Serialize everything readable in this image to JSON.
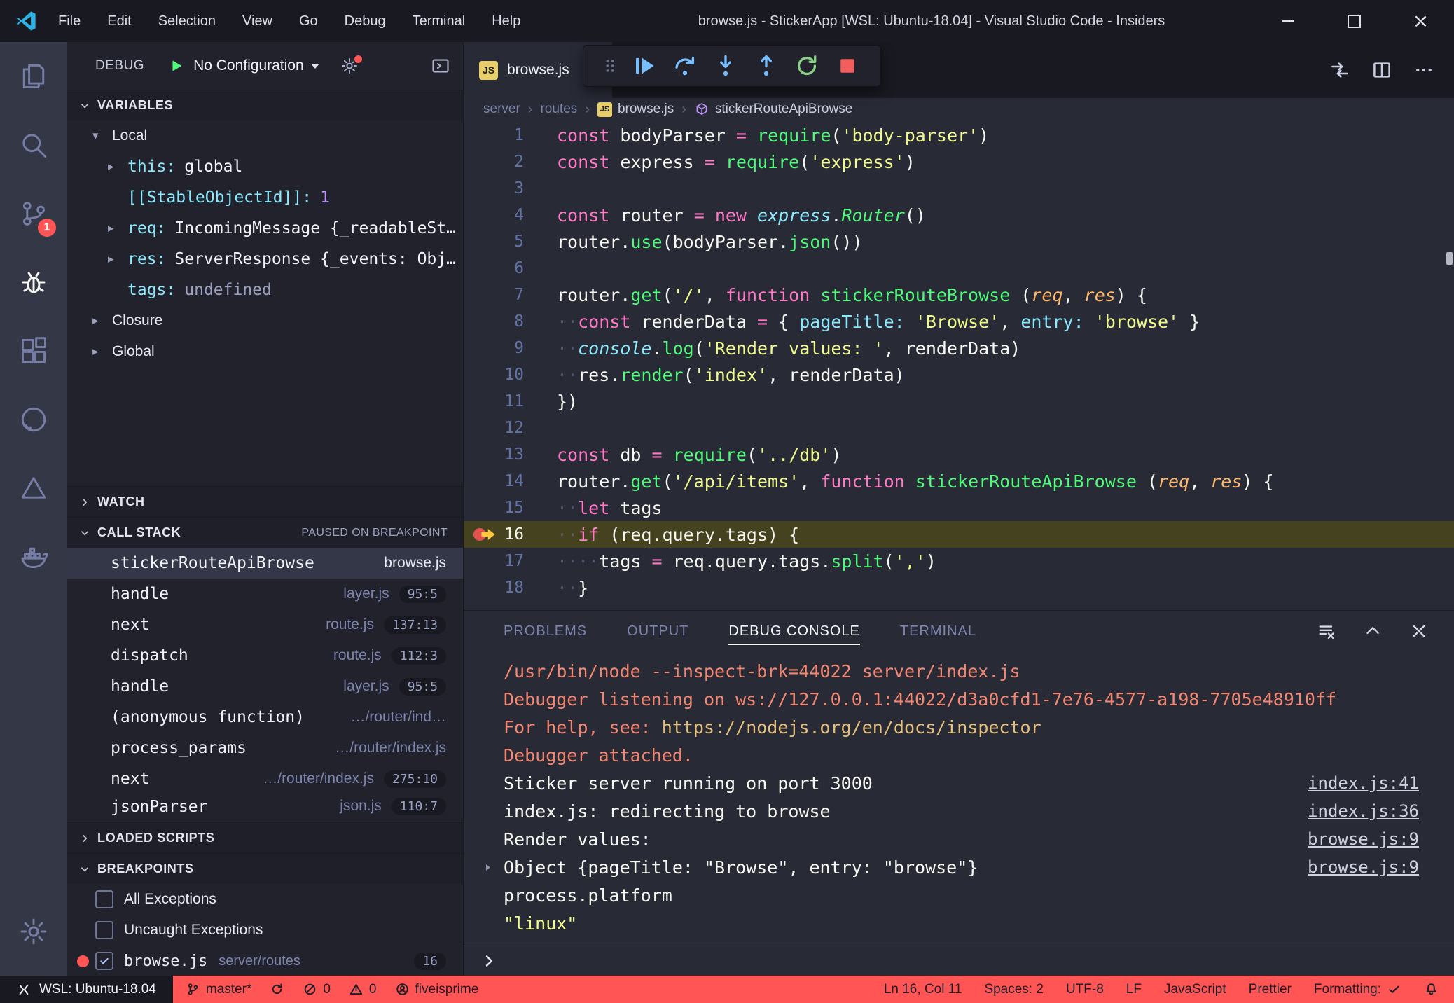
{
  "title_bar": {
    "title": "browse.js - StickerApp [WSL: Ubuntu-18.04] - Visual Studio Code - Insiders",
    "menus": [
      "File",
      "Edit",
      "Selection",
      "View",
      "Go",
      "Debug",
      "Terminal",
      "Help"
    ],
    "window_controls": [
      "minimize",
      "maximize",
      "close"
    ]
  },
  "activity_bar": {
    "items": [
      {
        "icon": "explorer"
      },
      {
        "icon": "search"
      },
      {
        "icon": "source-control",
        "badge": "1"
      },
      {
        "icon": "debug",
        "active": true
      },
      {
        "icon": "extensions"
      },
      {
        "icon": "github"
      },
      {
        "icon": "azure"
      },
      {
        "icon": "docker"
      }
    ],
    "bottom": [
      {
        "icon": "settings"
      }
    ]
  },
  "sidebar": {
    "header": {
      "title": "DEBUG",
      "config_label": "No Configuration"
    },
    "variables": {
      "label": "VARIABLES",
      "rows": [
        {
          "kind": "scope",
          "label": "Local",
          "chevron": "down"
        },
        {
          "kind": "var",
          "chevron": "right",
          "name": "this",
          "value": "global"
        },
        {
          "kind": "var",
          "name": "[[StableObjectId]]",
          "value": "1",
          "vclass": "num"
        },
        {
          "kind": "var",
          "chevron": "right",
          "name": "req",
          "value": "IncomingMessage {_readableSt…"
        },
        {
          "kind": "var",
          "chevron": "right",
          "name": "res",
          "value": "ServerResponse {_events: Obj…"
        },
        {
          "kind": "var",
          "name": "tags",
          "value": "undefined",
          "vclass": "muted"
        },
        {
          "kind": "scope",
          "label": "Closure",
          "chevron": "right"
        },
        {
          "kind": "scope",
          "label": "Global",
          "chevron": "right"
        }
      ]
    },
    "watch": {
      "label": "WATCH"
    },
    "call_stack": {
      "label": "CALL STACK",
      "status": "PAUSED ON BREAKPOINT",
      "frames": [
        {
          "name": "stickerRouteApiBrowse",
          "file": "browse.js",
          "selected": true
        },
        {
          "name": "handle",
          "file": "layer.js",
          "badge": "95:5"
        },
        {
          "name": "next",
          "file": "route.js",
          "badge": "137:13"
        },
        {
          "name": "dispatch",
          "file": "route.js",
          "badge": "112:3"
        },
        {
          "name": "handle",
          "file": "layer.js",
          "badge": "95:5"
        },
        {
          "name": "(anonymous function)",
          "file": "…/router/ind…"
        },
        {
          "name": "process_params",
          "file": "…/router/index.js"
        },
        {
          "name": "next",
          "file": "…/router/index.js",
          "badge": "275:10"
        },
        {
          "name": "jsonParser",
          "file": "json.js",
          "badge": "110:7",
          "clipped": true
        }
      ]
    },
    "loaded_scripts": {
      "label": "LOADED SCRIPTS"
    },
    "breakpoints": {
      "label": "BREAKPOINTS",
      "items": [
        {
          "label": "All Exceptions",
          "checked": false
        },
        {
          "label": "Uncaught Exceptions",
          "checked": false
        },
        {
          "label": "browse.js",
          "mono": true,
          "detail": "server/routes",
          "checked": true,
          "dot": true,
          "badge": "16"
        }
      ]
    }
  },
  "editor": {
    "tab": {
      "label": "browse.js",
      "icon_text": "JS"
    },
    "actions": [
      "open-changes",
      "split-editor",
      "more-actions"
    ],
    "debug_toolbar": [
      "grip",
      "continue",
      "step-over",
      "step-into",
      "step-out",
      "restart",
      "stop"
    ],
    "breadcrumbs": [
      {
        "label": "server"
      },
      {
        "label": "routes"
      },
      {
        "label": "browse.js",
        "icon": "js"
      },
      {
        "label": "stickerRouteApiBrowse",
        "icon": "symbol-method"
      }
    ],
    "code": {
      "current_line": 16,
      "lines": [
        {
          "n": 1,
          "t": [
            [
              "k",
              "const"
            ],
            [
              "v",
              " bodyParser "
            ],
            [
              "k",
              "="
            ],
            [
              "v",
              " "
            ],
            [
              "f",
              "require"
            ],
            [
              "v",
              "("
            ],
            [
              "s",
              "'body-parser'"
            ],
            [
              "v",
              ")"
            ]
          ]
        },
        {
          "n": 2,
          "t": [
            [
              "k",
              "const"
            ],
            [
              "v",
              " express "
            ],
            [
              "k",
              "="
            ],
            [
              "v",
              " "
            ],
            [
              "f",
              "require"
            ],
            [
              "v",
              "("
            ],
            [
              "s",
              "'express'"
            ],
            [
              "v",
              ")"
            ]
          ]
        },
        {
          "n": 3,
          "t": []
        },
        {
          "n": 4,
          "t": [
            [
              "k",
              "const"
            ],
            [
              "v",
              " router "
            ],
            [
              "k",
              "="
            ],
            [
              "v",
              " "
            ],
            [
              "k",
              "new"
            ],
            [
              "v",
              " "
            ],
            [
              "ci",
              "express"
            ],
            [
              "v",
              "."
            ],
            [
              "gi",
              "Router"
            ],
            [
              "v",
              "()"
            ]
          ]
        },
        {
          "n": 5,
          "t": [
            [
              "v",
              "router."
            ],
            [
              "f",
              "use"
            ],
            [
              "v",
              "("
            ],
            [
              "v",
              "bodyParser."
            ],
            [
              "f",
              "json"
            ],
            [
              "v",
              "())"
            ]
          ]
        },
        {
          "n": 6,
          "t": []
        },
        {
          "n": 7,
          "t": [
            [
              "v",
              "router."
            ],
            [
              "f",
              "get"
            ],
            [
              "v",
              "("
            ],
            [
              "s",
              "'/'"
            ],
            [
              "v",
              ", "
            ],
            [
              "k",
              "function"
            ],
            [
              "v",
              " "
            ],
            [
              "f",
              "stickerRouteBrowse"
            ],
            [
              "v",
              " ("
            ],
            [
              "ai",
              "req"
            ],
            [
              "v",
              ", "
            ],
            [
              "ai",
              "res"
            ],
            [
              "v",
              ") {"
            ]
          ]
        },
        {
          "n": 8,
          "t": [
            [
              "ws",
              "··"
            ],
            [
              "k",
              "const"
            ],
            [
              "v",
              " renderData "
            ],
            [
              "k",
              "="
            ],
            [
              "v",
              " { "
            ],
            [
              "key",
              "pageTitle:"
            ],
            [
              "v",
              " "
            ],
            [
              "s",
              "'Browse'"
            ],
            [
              "v",
              ", "
            ],
            [
              "key",
              "entry:"
            ],
            [
              "v",
              " "
            ],
            [
              "s",
              "'browse'"
            ],
            [
              "v",
              " }"
            ]
          ]
        },
        {
          "n": 9,
          "t": [
            [
              "ws",
              "··"
            ],
            [
              "ci",
              "console"
            ],
            [
              "v",
              "."
            ],
            [
              "f",
              "log"
            ],
            [
              "v",
              "("
            ],
            [
              "s",
              "'Render values: '"
            ],
            [
              "v",
              ", renderData)"
            ]
          ]
        },
        {
          "n": 10,
          "t": [
            [
              "ws",
              "··"
            ],
            [
              "v",
              "res."
            ],
            [
              "f",
              "render"
            ],
            [
              "v",
              "("
            ],
            [
              "s",
              "'index'"
            ],
            [
              "v",
              ", renderData)"
            ]
          ]
        },
        {
          "n": 11,
          "t": [
            [
              "v",
              "})"
            ]
          ]
        },
        {
          "n": 12,
          "t": []
        },
        {
          "n": 13,
          "t": [
            [
              "k",
              "const"
            ],
            [
              "v",
              " db "
            ],
            [
              "k",
              "="
            ],
            [
              "v",
              " "
            ],
            [
              "f",
              "require"
            ],
            [
              "v",
              "("
            ],
            [
              "s",
              "'../db'"
            ],
            [
              "v",
              ")"
            ]
          ]
        },
        {
          "n": 14,
          "t": [
            [
              "v",
              "router."
            ],
            [
              "f",
              "get"
            ],
            [
              "v",
              "("
            ],
            [
              "s",
              "'/api/items'"
            ],
            [
              "v",
              ", "
            ],
            [
              "k",
              "function"
            ],
            [
              "v",
              " "
            ],
            [
              "f",
              "stickerRouteApiBrowse"
            ],
            [
              "v",
              " ("
            ],
            [
              "ai",
              "req"
            ],
            [
              "v",
              ", "
            ],
            [
              "ai",
              "res"
            ],
            [
              "v",
              ") {"
            ]
          ]
        },
        {
          "n": 15,
          "t": [
            [
              "ws",
              "··"
            ],
            [
              "k",
              "let"
            ],
            [
              "v",
              " tags"
            ]
          ]
        },
        {
          "n": 16,
          "t": [
            [
              "ws",
              "··"
            ],
            [
              "k",
              "if"
            ],
            [
              "v",
              " (req.query.tags) {"
            ]
          ]
        },
        {
          "n": 17,
          "t": [
            [
              "ws",
              "····"
            ],
            [
              "v",
              "tags "
            ],
            [
              "k",
              "="
            ],
            [
              "v",
              " req.query.tags."
            ],
            [
              "f",
              "split"
            ],
            [
              "v",
              "("
            ],
            [
              "s",
              "','"
            ],
            [
              "v",
              ")"
            ]
          ]
        },
        {
          "n": 18,
          "t": [
            [
              "ws",
              "··"
            ],
            [
              "v",
              "}"
            ]
          ]
        }
      ]
    }
  },
  "panel": {
    "tabs": [
      {
        "label": "PROBLEMS"
      },
      {
        "label": "OUTPUT"
      },
      {
        "label": "DEBUG CONSOLE",
        "active": true
      },
      {
        "label": "TERMINAL"
      }
    ],
    "actions": [
      "clear-console",
      "chevron-up",
      "close"
    ],
    "lines": [
      {
        "segs": [
          [
            "err",
            "/usr/bin/node --inspect-brk=44022 server/index.js"
          ]
        ]
      },
      {
        "segs": [
          [
            "err",
            "Debugger listening on ws://127.0.0.1:44022/d3a0cfd1-7e76-4577-a198-7705e48910ff"
          ]
        ]
      },
      {
        "segs": [
          [
            "err",
            "For help, see: "
          ],
          [
            "gold",
            "https://nodejs.org/en/docs/inspector"
          ]
        ]
      },
      {
        "segs": [
          [
            "err",
            "Debugger attached."
          ]
        ]
      },
      {
        "segs": [
          [
            "fg",
            "Sticker server running on port 3000"
          ]
        ],
        "src": "index.js:41"
      },
      {
        "segs": [
          [
            "fg",
            "index.js: redirecting to browse"
          ]
        ],
        "src": "index.js:36"
      },
      {
        "segs": [
          [
            "fg",
            "Render values: "
          ]
        ],
        "src": "browse.js:9"
      },
      {
        "expand": true,
        "segs": [
          [
            "fg",
            "Object {pageTitle: \"Browse\", entry: \"browse\"}"
          ]
        ],
        "src": "browse.js:9"
      },
      {
        "segs": [
          [
            "fg",
            "process.platform"
          ]
        ]
      },
      {
        "segs": [
          [
            "str",
            "\"linux\""
          ]
        ]
      }
    ]
  },
  "status_bar": {
    "remote": {
      "icon": "remote",
      "label": "WSL: Ubuntu-18.04"
    },
    "left": [
      {
        "icon": "branch",
        "label": "master*",
        "name": "git-branch"
      },
      {
        "icon": "sync",
        "name": "sync"
      },
      {
        "icon": "error",
        "label": "0",
        "name": "errors"
      },
      {
        "icon": "warning",
        "label": "0",
        "name": "warnings"
      },
      {
        "icon": "account",
        "label": "fiveisprime",
        "name": "account"
      }
    ],
    "right": [
      {
        "label": "Ln 16, Col 11",
        "name": "cursor-position"
      },
      {
        "label": "Spaces: 2",
        "name": "indentation"
      },
      {
        "label": "UTF-8",
        "name": "encoding"
      },
      {
        "label": "LF",
        "name": "eol"
      },
      {
        "label": "JavaScript",
        "name": "language-mode"
      },
      {
        "label": "Prettier",
        "name": "formatter"
      },
      {
        "label": "Formatting:",
        "icon": "check",
        "name": "formatting-status"
      },
      {
        "icon": "bell",
        "name": "notifications"
      }
    ]
  }
}
